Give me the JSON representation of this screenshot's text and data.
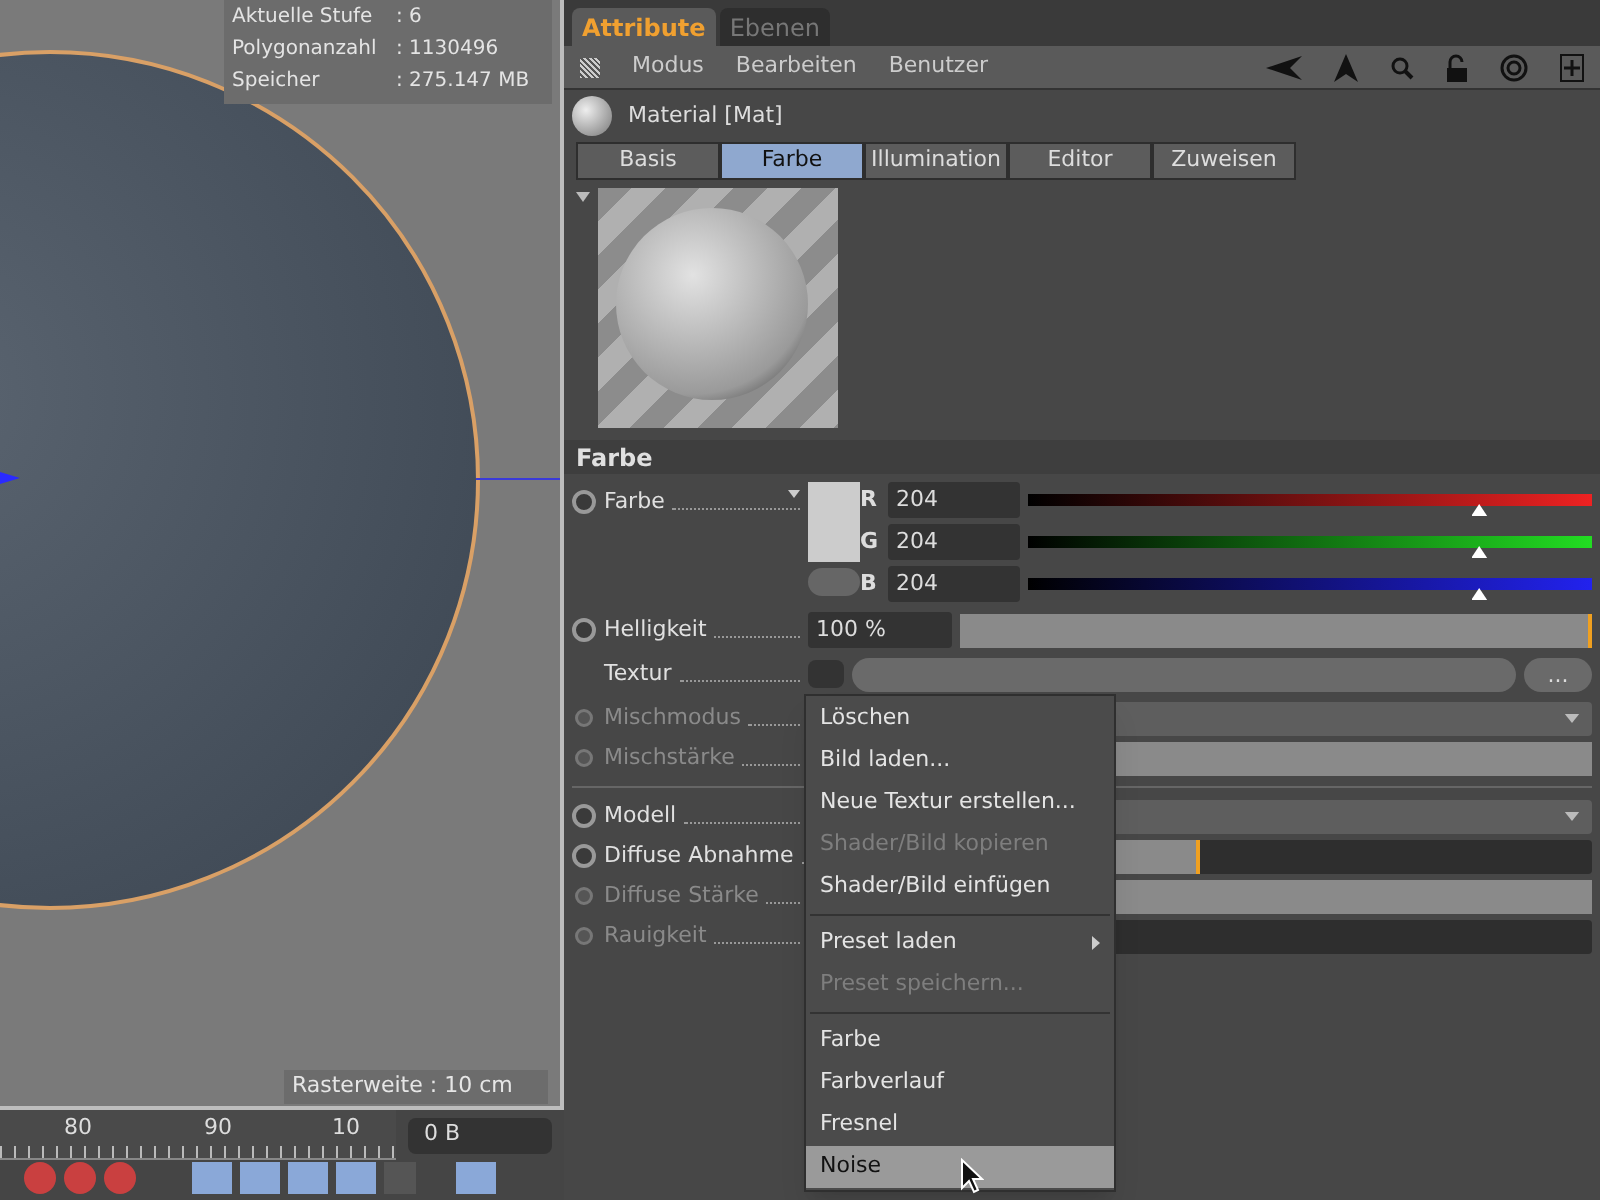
{
  "viewport": {
    "hud": [
      {
        "label": "Aktuelle Stufe",
        "value": ": 6"
      },
      {
        "label": "Polygonanzahl",
        "value": ": 1130496"
      },
      {
        "label": "Speicher",
        "value": ": 275.147 MB"
      }
    ],
    "grid_size": "Rasterweite : 10 cm"
  },
  "timeline": {
    "ticks": [
      "80",
      "90",
      "10"
    ],
    "frame_field": "0 B"
  },
  "panel_tabs": [
    {
      "label": "Attribute",
      "selected": true
    },
    {
      "label": "Ebenen",
      "selected": false
    }
  ],
  "menu_bar": [
    "Modus",
    "Bearbeiten",
    "Benutzer"
  ],
  "object_title": "Material [Mat]",
  "material_tabs": [
    {
      "label": "Basis",
      "selected": false
    },
    {
      "label": "Farbe",
      "selected": true
    },
    {
      "label": "Illumination",
      "selected": false
    },
    {
      "label": "Editor",
      "selected": false
    },
    {
      "label": "Zuweisen",
      "selected": false
    }
  ],
  "section_title": "Farbe",
  "params": [
    {
      "kind": "color",
      "label": "Farbe",
      "disabled": false,
      "channels": [
        {
          "name": "R",
          "value": "204",
          "level": 0.8
        },
        {
          "name": "G",
          "value": "204",
          "level": 0.8
        },
        {
          "name": "B",
          "value": "204",
          "level": 0.8
        }
      ]
    },
    {
      "kind": "slider",
      "label": "Helligkeit",
      "disabled": false,
      "value": "100 %",
      "level": 1
    },
    {
      "kind": "texture",
      "label": "Textur",
      "button": "..."
    },
    {
      "kind": "dropdown",
      "label": "Mischmodus",
      "disabled": true
    },
    {
      "kind": "slider",
      "label": "Mischstärke",
      "disabled": true,
      "level": 1
    },
    {
      "kind": "divider"
    },
    {
      "kind": "dropdown",
      "label": "Modell",
      "disabled": false
    },
    {
      "kind": "slider",
      "label": "Diffuse Abnahme",
      "disabled": false,
      "level": 0.5
    },
    {
      "kind": "slider",
      "label": "Diffuse Stärke",
      "disabled": true,
      "level": 1
    },
    {
      "kind": "slider",
      "label": "Rauigkeit",
      "disabled": true,
      "level": 0
    }
  ],
  "context_menu": [
    {
      "kind": "item",
      "label": "Löschen",
      "disabled": false,
      "selected": false
    },
    {
      "kind": "item",
      "label": "Bild laden...",
      "disabled": false,
      "selected": false
    },
    {
      "kind": "item",
      "label": "Neue Textur erstellen...",
      "disabled": false,
      "selected": false
    },
    {
      "kind": "item",
      "label": "Shader/Bild kopieren",
      "disabled": true,
      "selected": false
    },
    {
      "kind": "item",
      "label": "Shader/Bild einfügen",
      "disabled": false,
      "selected": false
    },
    {
      "kind": "separator"
    },
    {
      "kind": "submenu",
      "label": "Preset laden",
      "disabled": false,
      "selected": false
    },
    {
      "kind": "item",
      "label": "Preset speichern...",
      "disabled": true,
      "selected": false
    },
    {
      "kind": "separator"
    },
    {
      "kind": "item",
      "label": "Farbe",
      "disabled": false,
      "selected": false
    },
    {
      "kind": "item",
      "label": "Farbverlauf",
      "disabled": false,
      "selected": false
    },
    {
      "kind": "item",
      "label": "Fresnel",
      "disabled": false,
      "selected": false
    },
    {
      "kind": "item",
      "label": "Noise",
      "disabled": false,
      "selected": true
    }
  ]
}
